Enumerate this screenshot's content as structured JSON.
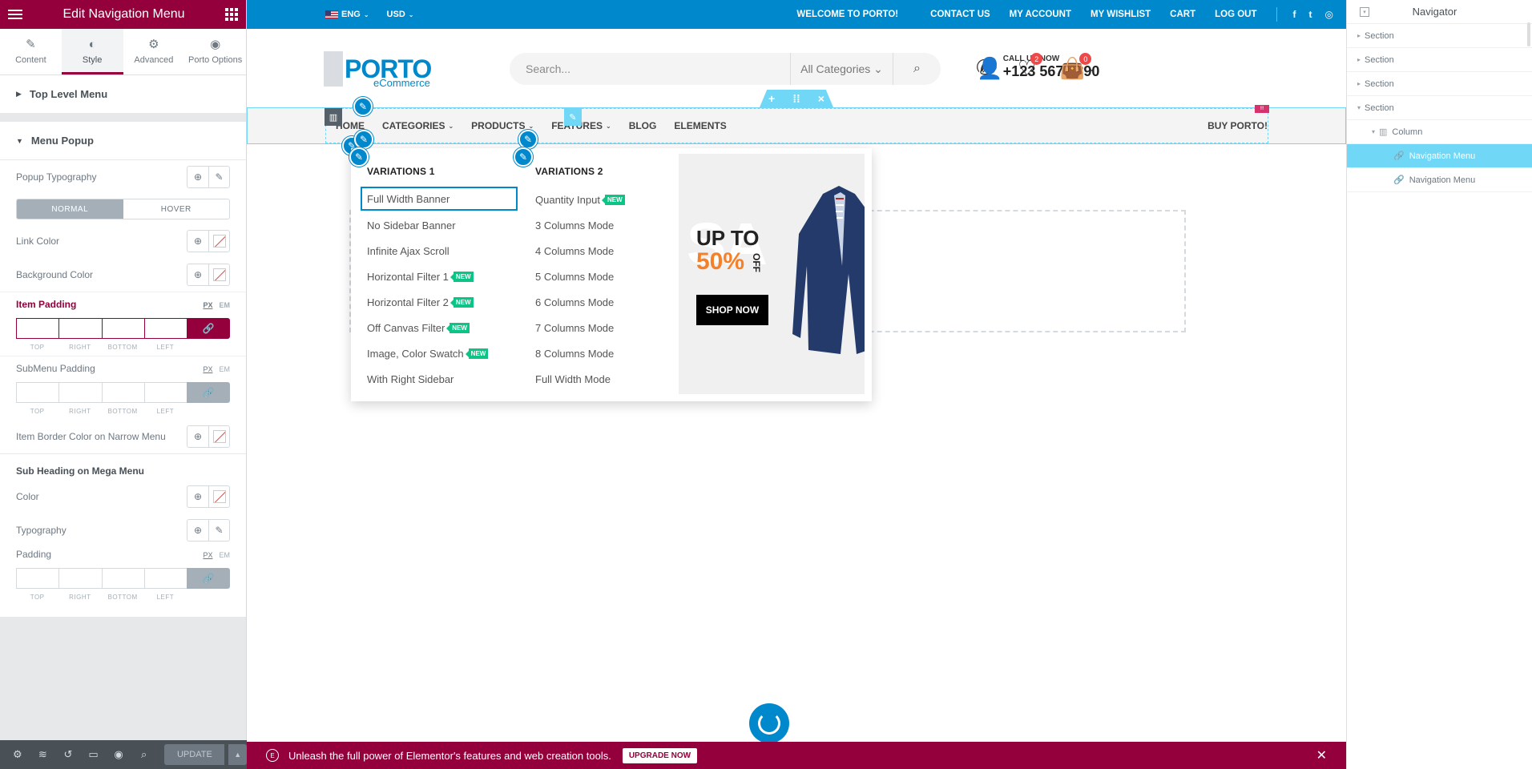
{
  "left_panel": {
    "title": "Edit Navigation Menu",
    "tabs": [
      {
        "label": "Content",
        "icon": "pencil-icon"
      },
      {
        "label": "Style",
        "icon": "half-circle-icon"
      },
      {
        "label": "Advanced",
        "icon": "gear-icon"
      },
      {
        "label": "Porto Options",
        "icon": "circle-dot-icon"
      }
    ],
    "top_level_menu": "Top Level Menu",
    "menu_popup": "Menu Popup",
    "popup_typography": "Popup Typography",
    "state_tabs": [
      "NORMAL",
      "HOVER"
    ],
    "link_color": "Link Color",
    "background_color": "Background Color",
    "item_padding": "Item Padding",
    "submenu_padding": "SubMenu Padding",
    "units": [
      "PX",
      "EM"
    ],
    "pad_labels": [
      "TOP",
      "RIGHT",
      "BOTTOM",
      "LEFT"
    ],
    "item_border_color": "Item Border Color on Narrow Menu",
    "sub_heading": "Sub Heading on Mega Menu",
    "color": "Color",
    "typography": "Typography",
    "padding": "Padding",
    "footer": {
      "update": "UPDATE"
    }
  },
  "site": {
    "topbar": {
      "lang": "ENG",
      "currency": "USD",
      "welcome": "WELCOME TO PORTO!",
      "links": [
        "CONTACT US",
        "MY ACCOUNT",
        "MY WISHLIST",
        "CART",
        "LOG OUT"
      ],
      "social": [
        "f",
        "t",
        "◎"
      ]
    },
    "logo": {
      "main": "PORTO",
      "sub": "eCommerce"
    },
    "search": {
      "placeholder": "Search...",
      "category": "All Categories"
    },
    "phone": {
      "label": "CALL US NOW",
      "number": "+123 5678 890"
    },
    "wishlist_count": "2",
    "cart_count": "0",
    "nav": {
      "items": [
        "HOME",
        "CATEGORIES",
        "PRODUCTS",
        "FEATURES",
        "BLOG",
        "ELEMENTS"
      ],
      "buy": "BUY PORTO!"
    },
    "mega_menu": {
      "col1_title": "VARIATIONS 1",
      "col1": [
        {
          "label": "Full Width Banner",
          "new": false
        },
        {
          "label": "No Sidebar Banner",
          "new": false
        },
        {
          "label": "Infinite Ajax Scroll",
          "new": false
        },
        {
          "label": "Horizontal Filter 1",
          "new": true
        },
        {
          "label": "Horizontal Filter 2",
          "new": true
        },
        {
          "label": "Off Canvas Filter",
          "new": true
        },
        {
          "label": "Image, Color Swatch",
          "new": true
        },
        {
          "label": "With Right Sidebar",
          "new": false
        }
      ],
      "col2_title": "VARIATIONS 2",
      "col2": [
        {
          "label": "Quantity Input",
          "new": true
        },
        {
          "label": "3 Columns Mode",
          "new": false
        },
        {
          "label": "4 Columns Mode",
          "new": false
        },
        {
          "label": "5 Columns Mode",
          "new": false
        },
        {
          "label": "6 Columns Mode",
          "new": false
        },
        {
          "label": "7 Columns Mode",
          "new": false
        },
        {
          "label": "8 Columns Mode",
          "new": false
        },
        {
          "label": "Full Width Mode",
          "new": false
        }
      ],
      "new_label": "NEW",
      "promo": {
        "bg": "SA",
        "line1": "UP TO",
        "line2": "50%",
        "off": "OFF",
        "button": "SHOP NOW"
      }
    },
    "promo_bar": {
      "text": "Unleash the full power of Elementor's features and web creation tools.",
      "button": "UPGRADE NOW"
    }
  },
  "navigator": {
    "title": "Navigator",
    "rows": [
      {
        "label": "Section",
        "level": 0,
        "arrow": "▸",
        "active": false
      },
      {
        "label": "Section",
        "level": 0,
        "arrow": "▸",
        "active": false
      },
      {
        "label": "Section",
        "level": 0,
        "arrow": "▸",
        "active": false
      },
      {
        "label": "Section",
        "level": 0,
        "arrow": "▾",
        "active": false
      },
      {
        "label": "Column",
        "level": 1,
        "arrow": "▾",
        "active": false
      },
      {
        "label": "Navigation Menu",
        "level": 2,
        "arrow": "",
        "active": true
      },
      {
        "label": "Navigation Menu",
        "level": 2,
        "arrow": "",
        "active": false
      }
    ]
  },
  "colors": {
    "elementor": "#93003c",
    "porto_blue": "#0088cc",
    "selection_cyan": "#71d7f7",
    "new_badge": "#0cc485"
  }
}
